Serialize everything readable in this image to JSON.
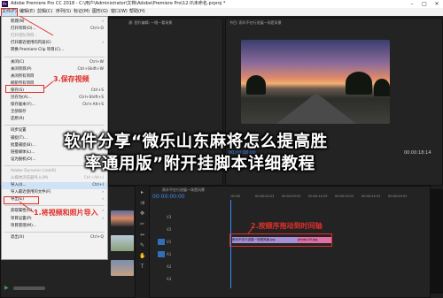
{
  "window": {
    "title": "Adobe Premiere Pro CC 2018 - C:\\用户\\Administrator\\文档\\Adobe\\Premiere Pro\\12.0\\未命名.prproj *",
    "app_icon": "Pr"
  },
  "menubar": [
    "文件(F)",
    "编辑(E)",
    "剪辑(C)",
    "序列(S)",
    "标记(M)",
    "图形(G)",
    "窗口(W)",
    "帮助(H)"
  ],
  "file_menu": [
    {
      "label": "新建(N)",
      "shortcut": "",
      "arrow": true
    },
    {
      "label": "打开项目(O)...",
      "shortcut": "Ctrl+O"
    },
    {
      "label": "打开团队项目...",
      "shortcut": "",
      "disabled": true
    },
    {
      "label": "打开最近使用的内容(E)",
      "shortcut": "",
      "arrow": true
    },
    {
      "label": "转换 Premiere Clip 项目(C)...",
      "shortcut": ""
    },
    {
      "sep": true
    },
    {
      "label": "关闭(C)",
      "shortcut": "Ctrl+W"
    },
    {
      "label": "关闭项目(P)",
      "shortcut": "Ctrl+Shift+W"
    },
    {
      "label": "关闭所有项目",
      "shortcut": ""
    },
    {
      "label": "刷新所有项目",
      "shortcut": ""
    },
    {
      "label": "保存(S)",
      "shortcut": "Ctrl+S",
      "boxed": true
    },
    {
      "label": "另存为(A)...",
      "shortcut": "Ctrl+Shift+S"
    },
    {
      "label": "保存副本(Y)...",
      "shortcut": "Ctrl+Alt+S"
    },
    {
      "label": "全部保存",
      "shortcut": ""
    },
    {
      "label": "还原(R)",
      "shortcut": ""
    },
    {
      "sep": true
    },
    {
      "label": "同步设置",
      "shortcut": "",
      "arrow": true
    },
    {
      "label": "捕捉(T)...",
      "shortcut": "F5"
    },
    {
      "label": "批量捕捉(B)...",
      "shortcut": "F6"
    },
    {
      "label": "链接媒体(L)...",
      "shortcut": ""
    },
    {
      "label": "设为脱机(O)...",
      "shortcut": ""
    },
    {
      "sep": true
    },
    {
      "label": "Adobe Dynamic Link(K)",
      "shortcut": "",
      "arrow": true,
      "disabled": true
    },
    {
      "label": "从媒体浏览器导入(M)",
      "shortcut": "Ctrl+Alt+I",
      "disabled": true
    },
    {
      "label": "导入(I)...",
      "shortcut": "Ctrl+I",
      "highlight": true
    },
    {
      "label": "导入最近使用的文件(F)",
      "shortcut": "",
      "arrow": true
    },
    {
      "label": "导出(E)",
      "shortcut": "",
      "arrow": true
    },
    {
      "sep": true
    },
    {
      "label": "获取属性(G)",
      "shortcut": "",
      "arrow": true
    },
    {
      "label": "项目设置(P)",
      "shortcut": "",
      "arrow": true
    },
    {
      "label": "项目管理(M)...",
      "shortcut": ""
    },
    {
      "sep": true
    },
    {
      "label": "退出(X)",
      "shortcut": "Ctrl+Q"
    }
  ],
  "annotations": {
    "step1": "1.将视频和照片导入",
    "step2": "2.按顺序拖动到时间轴",
    "step3": "3.保存视频"
  },
  "overlay": {
    "line1": "软件分享“微乐山东麻将怎么提高胜",
    "line2": "率通用版”附开挂脚本详细教程"
  },
  "source_panel": {
    "tab": "源: 图片编辑: 一眼一看场景"
  },
  "program_panel": {
    "tab": "节目: 雨伞不在行进展一场是风景",
    "timecode_left": "00:00:00:00",
    "timecode_right": "00:00:18:14",
    "fit": "适合"
  },
  "timeline": {
    "tab": "雨伞不在行进展一场是风景",
    "timecode": "00:00:00:00",
    "ruler": [
      ":00:00",
      "00:00:04:23",
      "00:00:09:23",
      "00:00:14:23",
      "00:00:19:23",
      "00:00:24:23",
      "00:00:29:23"
    ],
    "tracks": [
      "V3",
      "V2",
      "V1",
      "A1",
      "A2",
      "A3"
    ],
    "clip_label": "雨伞不在行进展一场是风景.jpg",
    "clip_label2": "photo-05.jpg"
  },
  "colors": {
    "accent_red": "#e0302a",
    "timecode_blue": "#3d8df5",
    "clip_purple": "#a58fd6",
    "clip_pink": "#e06fa6"
  }
}
